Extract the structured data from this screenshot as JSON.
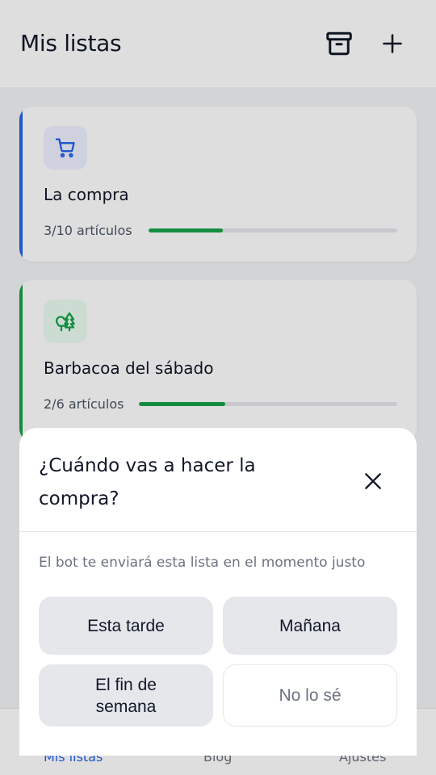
{
  "header": {
    "title": "Mis listas",
    "archive_icon": "archive-icon",
    "add_icon": "plus-icon"
  },
  "lists": [
    {
      "title": "La compra",
      "count": "3/10 artículos",
      "progress": 0.3,
      "accent": "#2563eb",
      "icon": "shopping-cart-icon",
      "icon_color": "#2563eb",
      "icon_bg": "#eef2ff"
    },
    {
      "title": "Barbacoa del sábado",
      "count": "2/6 artículos",
      "progress": 0.333,
      "accent": "#16a34a",
      "icon": "trees-icon",
      "icon_color": "#16a34a",
      "icon_bg": "#ecfdf3"
    }
  ],
  "bottom_nav": {
    "items": [
      {
        "label": "Mis listas",
        "active": true
      },
      {
        "label": "Blog",
        "active": false
      },
      {
        "label": "Ajustes",
        "active": false
      }
    ]
  },
  "sheet": {
    "title": "¿Cuándo vas a hacer la compra?",
    "subtitle": "El bot te enviará esta lista en el momento justo",
    "close_icon": "close-icon",
    "options": [
      {
        "label": "Esta tarde"
      },
      {
        "label": "Mañana"
      },
      {
        "label": "El fin de semana"
      },
      {
        "label": "No lo sé"
      }
    ]
  },
  "colors": {
    "accent_blue": "#2563eb",
    "accent_green": "#16a34a",
    "overlay": "rgba(0,0,0,0.13)"
  }
}
